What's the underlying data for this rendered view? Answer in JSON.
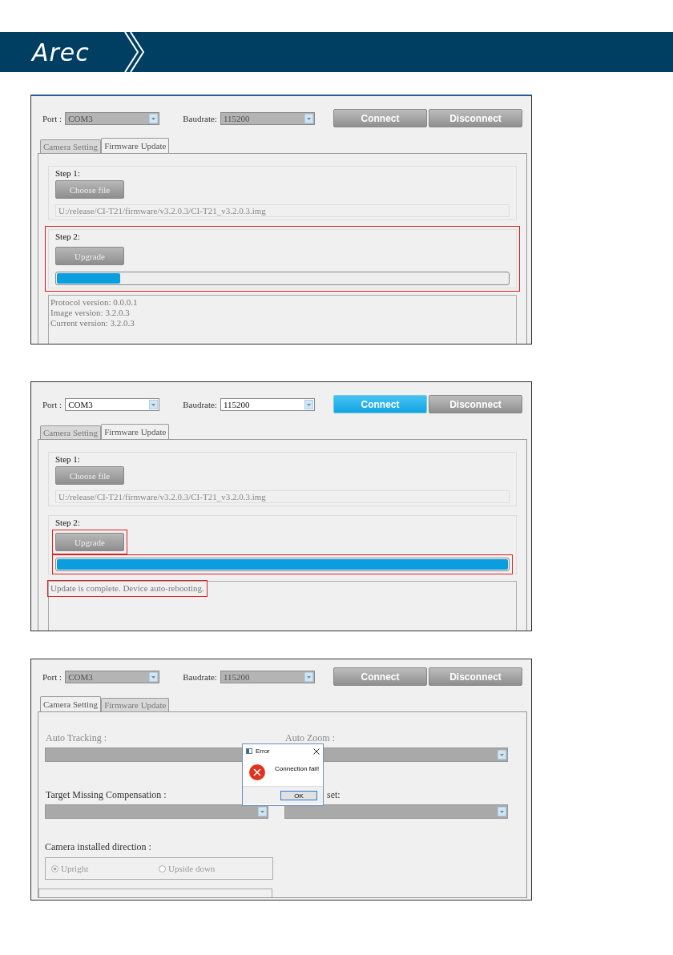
{
  "header": {
    "logo": "Arec"
  },
  "screens": [
    {
      "kind": "firmware",
      "port": {
        "label": "Port :",
        "value": "COM3",
        "disabled": true
      },
      "baudrate": {
        "label": "Baudrate:",
        "value": "115200",
        "disabled": true
      },
      "buttons": [
        {
          "label": "Connect",
          "active": false
        },
        {
          "label": "Disconnect",
          "active": false
        }
      ],
      "tabs": [
        {
          "label": "Camera Setting",
          "selected": false
        },
        {
          "label": "Firmware Update",
          "selected": true
        }
      ],
      "step1": {
        "label": "Step 1:",
        "button": "Choose file",
        "path": "U:/release/CI-T21/firmware/v3.2.0.3/CI-T21_v3.2.0.3.img"
      },
      "step2": {
        "label": "Step 2:",
        "button": "Upgrade",
        "level": 0.14,
        "highlighted": true,
        "button_highlighted": false,
        "progress_highlighted": false
      },
      "log": {
        "lines": [
          "Protocol version: 0.0.0.1",
          "Image version: 3.2.0.3",
          "Current version: 3.2.0.3"
        ],
        "highlighted": false
      }
    },
    {
      "kind": "firmware",
      "port": {
        "label": "Port :",
        "value": "COM3",
        "disabled": false
      },
      "baudrate": {
        "label": "Baudrate:",
        "value": "115200",
        "disabled": false
      },
      "buttons": [
        {
          "label": "Connect",
          "active": true
        },
        {
          "label": "Disconnect",
          "active": false
        }
      ],
      "tabs": [
        {
          "label": "Camera Setting",
          "selected": false
        },
        {
          "label": "Firmware Update",
          "selected": true
        }
      ],
      "step1": {
        "label": "Step 1:",
        "button": "Choose file",
        "path": "U:/release/CI-T21/firmware/v3.2.0.3/CI-T21_v3.2.0.3.img"
      },
      "step2": {
        "label": "Step 2:",
        "button": "Upgrade",
        "level": 1,
        "highlighted": false,
        "button_highlighted": true,
        "progress_highlighted": true
      },
      "log": {
        "lines": [
          "Update is complete. Device auto-rebooting."
        ],
        "highlighted": true
      }
    },
    {
      "kind": "camera",
      "port": {
        "label": "Port :",
        "value": "COM3",
        "disabled": true
      },
      "baudrate": {
        "label": "Baudrate:",
        "value": "115200",
        "disabled": true
      },
      "buttons": [
        {
          "label": "Connect",
          "active": false
        },
        {
          "label": "Disconnect",
          "active": false
        }
      ],
      "tabs": [
        {
          "label": "Camera Setting",
          "selected": true
        },
        {
          "label": "Firmware Update",
          "selected": false
        }
      ],
      "fields": [
        {
          "label": "Auto Tracking :"
        },
        {
          "label": "Auto Zoom :"
        },
        {
          "label": "Target Missing Compensation :"
        },
        {
          "label": "set:"
        }
      ],
      "direction": {
        "label": "Camera installed direction :",
        "options": [
          {
            "label": "Upright",
            "selected": true
          },
          {
            "label": "Upside down",
            "selected": false
          }
        ]
      },
      "dialog": {
        "title": "Error",
        "message": "Connection fail!",
        "button": "OK"
      }
    }
  ]
}
